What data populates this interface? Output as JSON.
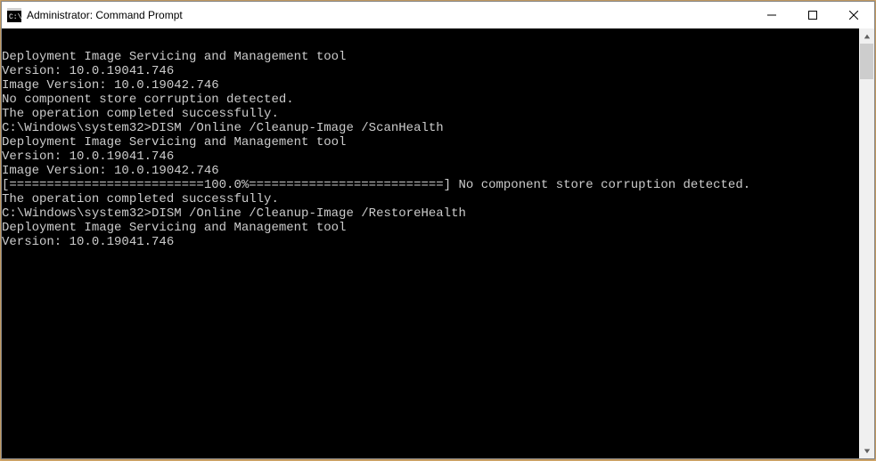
{
  "window": {
    "title": "Administrator: Command Prompt"
  },
  "terminal": {
    "lines": [
      "Deployment Image Servicing and Management tool",
      "Version: 10.0.19041.746",
      "",
      "Image Version: 10.0.19042.746",
      "",
      "No component store corruption detected.",
      "The operation completed successfully.",
      "",
      "C:\\Windows\\system32>DISM /Online /Cleanup-Image /ScanHealth",
      "",
      "Deployment Image Servicing and Management tool",
      "Version: 10.0.19041.746",
      "",
      "Image Version: 10.0.19042.746",
      "",
      "[==========================100.0%==========================] No component store corruption detected.",
      "The operation completed successfully.",
      "",
      "C:\\Windows\\system32>DISM /Online /Cleanup-Image /RestoreHealth",
      "",
      "Deployment Image Servicing and Management tool",
      "Version: 10.0.19041.746"
    ]
  }
}
